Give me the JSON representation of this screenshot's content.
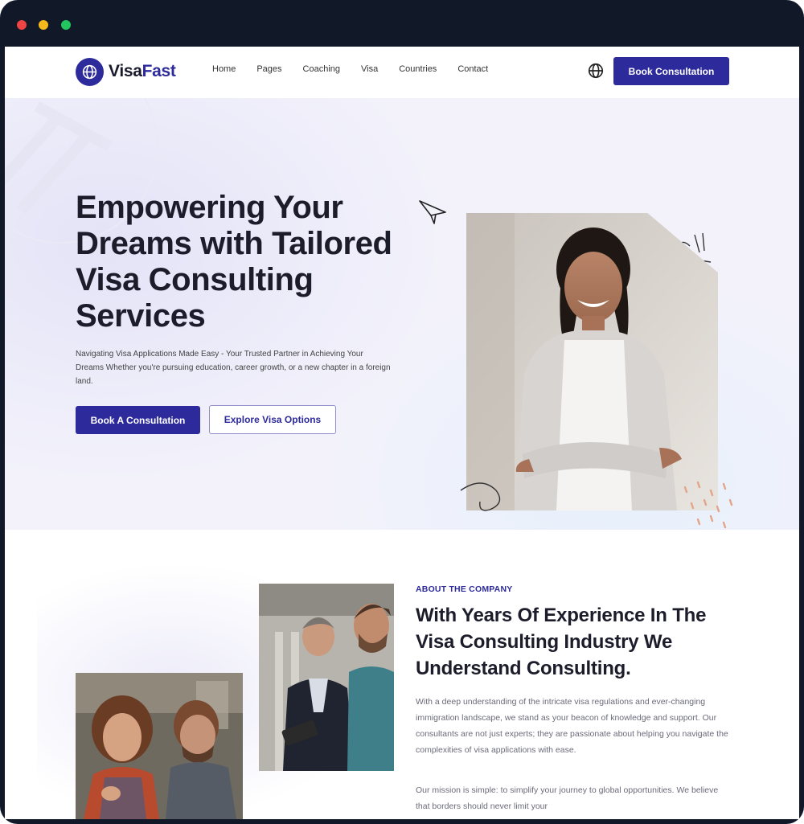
{
  "nav": {
    "logo_prefix": "Visa",
    "logo_suffix": "Fast",
    "links": [
      "Home",
      "Pages",
      "Coaching",
      "Visa",
      "Countries",
      "Contact"
    ],
    "cta_label": "Book Consultation"
  },
  "hero": {
    "title": "Empowering Your Dreams with Tailored Visa Consulting Services",
    "description": "Navigating Visa Applications Made Easy - Your Trusted Partner in Achieving Your Dreams Whether you're pursuing education, career growth, or a new chapter in a foreign land.",
    "primary_button": "Book A Consultation",
    "secondary_button": "Explore Visa Options"
  },
  "about": {
    "eyebrow": "ABOUT THE COMPANY",
    "title": "With Years Of Experience In The Visa Consulting Industry We Understand Consulting.",
    "paragraph1": "With a deep understanding of the intricate visa regulations and ever-changing immigration landscape, we stand as your beacon of knowledge and support. Our consultants are not just experts; they are passionate about helping you navigate the complexities of visa applications with ease.",
    "paragraph2": "Our mission is simple: to simplify your journey to global opportunities. We believe that borders should never limit your"
  },
  "colors": {
    "brand": "#2d2a9c",
    "hero_bg": "#f3f2fb",
    "frame": "#111827"
  },
  "icons": {
    "logo": "globe-logo-icon",
    "language": "globe-icon",
    "decoration": "paper-plane-icon"
  }
}
